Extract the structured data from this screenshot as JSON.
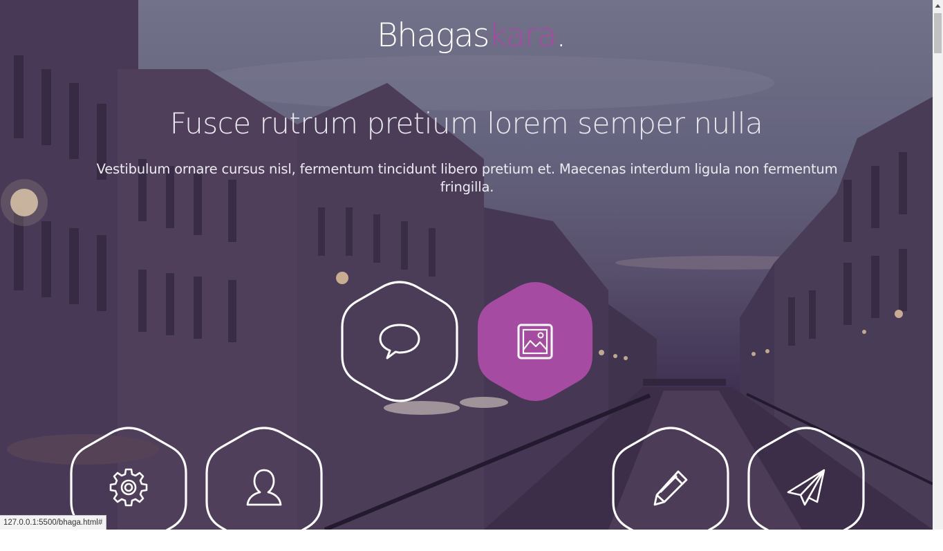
{
  "brand": {
    "primary": "Bhagas",
    "accent": "kara",
    "dot": ".",
    "accent_color": "#a64ba2"
  },
  "hero": {
    "headline": "Fusce rutrum pretium lorem semper nulla",
    "subtext": "Vestibulum ornare cursus nisl, fermentum tincidunt libero pretium et. Maecenas interdum ligula non fermentum fringilla."
  },
  "features": [
    {
      "icon": "speech-bubble-icon",
      "active": false
    },
    {
      "icon": "image-icon",
      "active": true
    },
    {
      "icon": "gear-icon",
      "active": false
    },
    {
      "icon": "user-icon",
      "active": false
    },
    {
      "icon": "pencil-icon",
      "active": false
    },
    {
      "icon": "paper-plane-icon",
      "active": false
    }
  ],
  "status_bar": {
    "url": "127.0.0.1:5500/bhaga.html#"
  }
}
